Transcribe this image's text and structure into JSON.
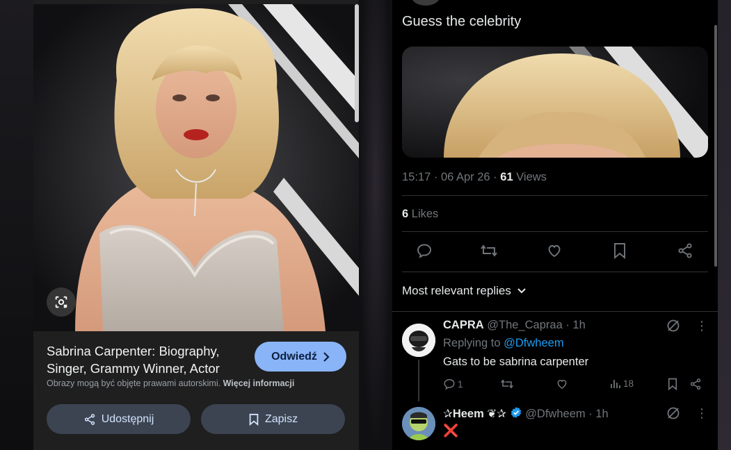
{
  "lens": {
    "title": "Sabrina Carpenter: Biography, Singer, Grammy Winner, Actor",
    "visit_label": "Odwiedź",
    "copyright_text": "Obrazy mogą być objęte prawami autorskimi.",
    "more_info_label": "Więcej informacji",
    "share_label": "Udostępnij",
    "save_label": "Zapisz",
    "lens_icon": "lens-search-icon"
  },
  "post": {
    "text": "Guess the celebrity",
    "time": "15:17 · 06 Apr 26 · ",
    "views_count": "61",
    "views_label": " Views",
    "likes_count": "6",
    "likes_label": " Likes",
    "actions": [
      "reply-icon",
      "repost-icon",
      "like-icon",
      "bookmark-icon",
      "share-icon"
    ],
    "sort_label": "Most relevant replies"
  },
  "replies": [
    {
      "name": "CAPRA",
      "handle": "@The_Capraa · 1h",
      "replying_prefix": "Replying to ",
      "replying_to": "@Dfwheem",
      "text": "Gats to be sabrina carpenter",
      "reply_count": "1",
      "views": "18"
    },
    {
      "name": "✰Heem ❦✰",
      "handle": "@Dfwheem · 1h",
      "text": "❌",
      "verified": true
    }
  ],
  "colors": {
    "link": "#1d9bf0",
    "muted": "#71767b",
    "visit_button": "#8ab4f8",
    "lens_button": "#3c4452"
  }
}
